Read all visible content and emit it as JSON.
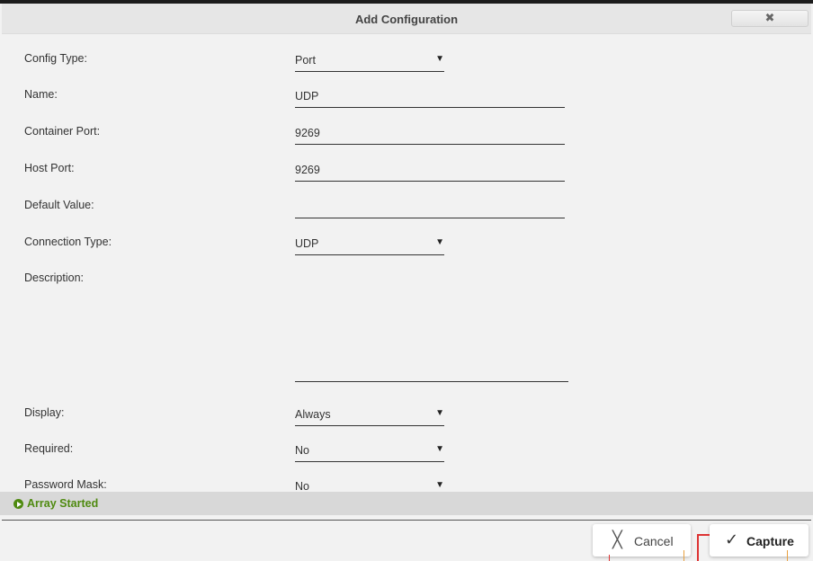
{
  "dialog": {
    "title": "Add Configuration",
    "close_icon": "close-icon"
  },
  "form": {
    "config_type": {
      "label": "Config Type:",
      "value": "Port"
    },
    "name": {
      "label": "Name:",
      "value": "UDP"
    },
    "container_port": {
      "label": "Container Port:",
      "value": "9269"
    },
    "host_port": {
      "label": "Host Port:",
      "value": "9269"
    },
    "default_value": {
      "label": "Default Value:",
      "value": ""
    },
    "connection_type": {
      "label": "Connection Type:",
      "value": "UDP"
    },
    "description": {
      "label": "Description:",
      "value": ""
    },
    "display": {
      "label": "Display:",
      "value": "Always"
    },
    "required": {
      "label": "Required:",
      "value": "No"
    },
    "password_mask": {
      "label": "Password Mask:",
      "value": "No"
    }
  },
  "status_bar": {
    "text": "Array Started",
    "color": "#4f8a10"
  },
  "buttons": {
    "cancel": {
      "label": "Cancel",
      "icon": "x-icon"
    },
    "capture": {
      "label": "Capture",
      "icon": "check-icon"
    }
  }
}
